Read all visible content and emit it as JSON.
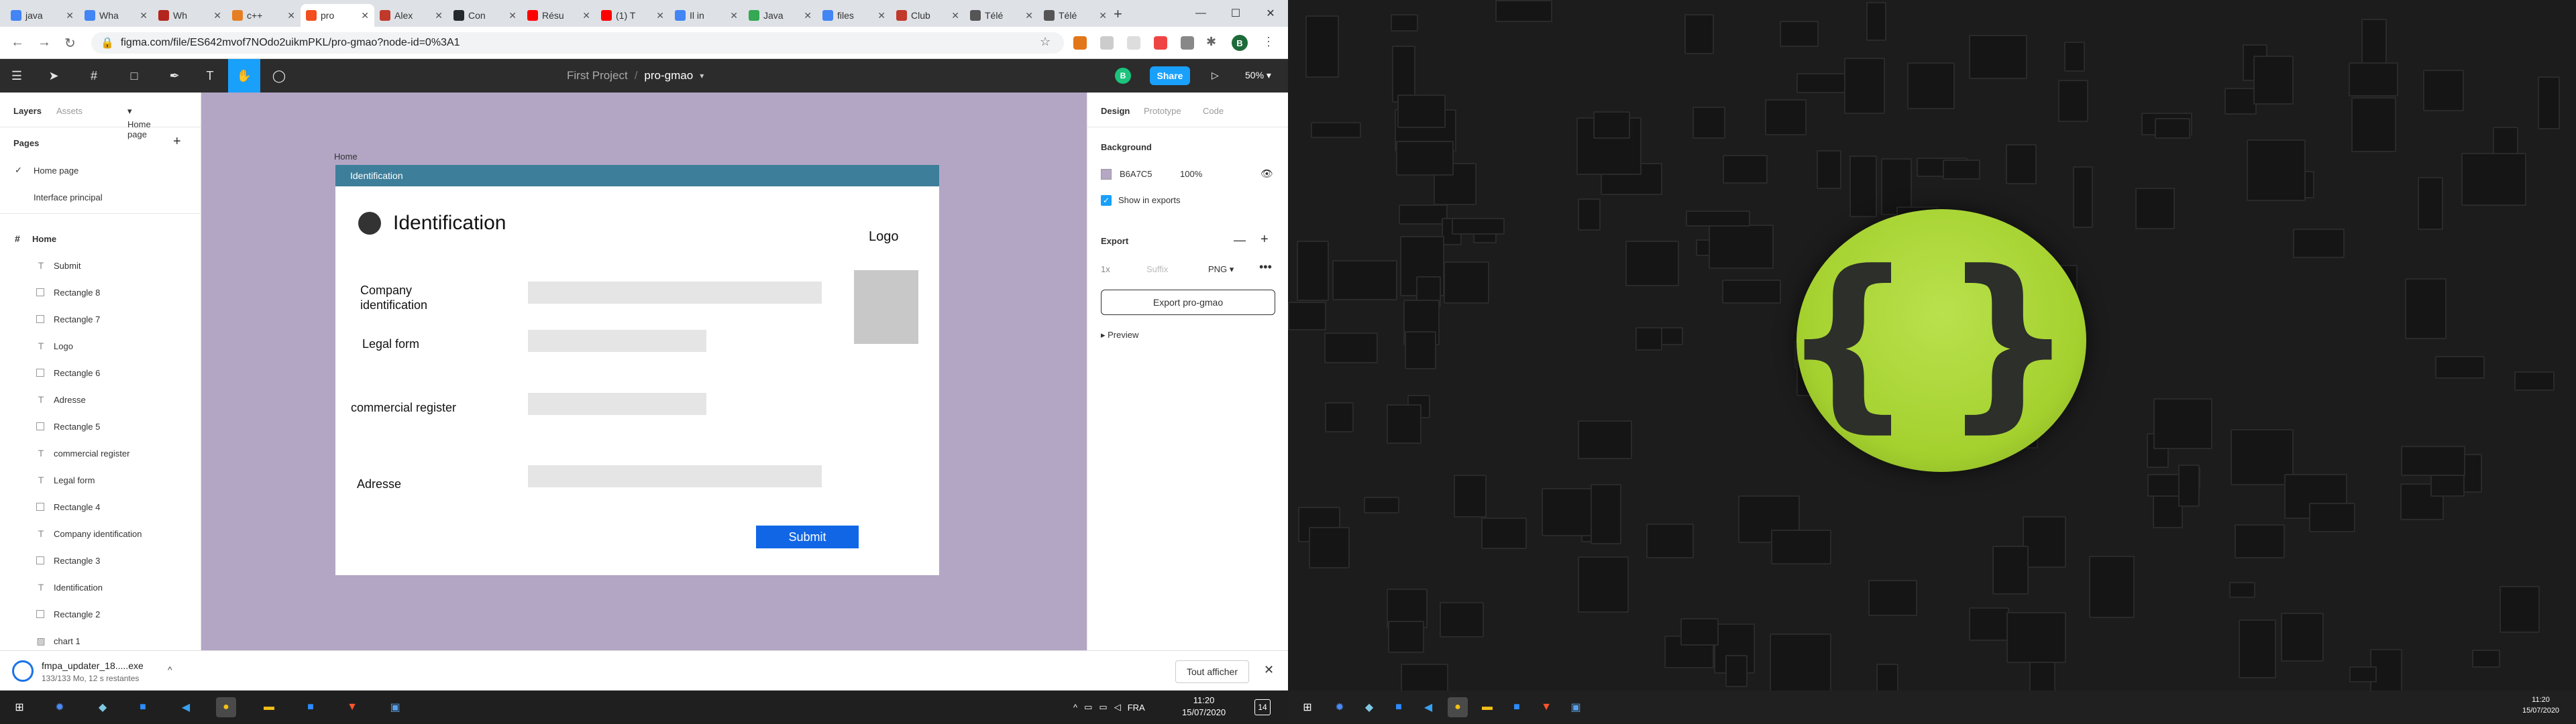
{
  "browser": {
    "tabs": [
      {
        "label": "java",
        "color": "#4285f4"
      },
      {
        "label": "Wha",
        "color": "#4285f4"
      },
      {
        "label": "Wh",
        "color": "#b3261e"
      },
      {
        "label": "c++",
        "color": "#e67e22"
      },
      {
        "label": "pro",
        "color": "#f24e1e"
      },
      {
        "label": "Alex",
        "color": "#c0392b"
      },
      {
        "label": "Con",
        "color": "#24292e"
      },
      {
        "label": "Résu",
        "color": "#ff0000"
      },
      {
        "label": "(1) T",
        "color": "#ff0000"
      },
      {
        "label": "Il in",
        "color": "#4285f4"
      },
      {
        "label": "Java",
        "color": "#34a853"
      },
      {
        "label": "files",
        "color": "#4285f4"
      },
      {
        "label": "Club",
        "color": "#c0392b"
      },
      {
        "label": "Télé",
        "color": "#555555"
      },
      {
        "label": "Télé",
        "color": "#555555"
      }
    ],
    "url": "figma.com/file/ES642mvof7NOdo2uikmPKL/pro-gmao?node-id=0%3A1",
    "profile_initial": "B"
  },
  "figma": {
    "breadcrumb_project": "First Project",
    "breadcrumb_sep": "/",
    "file_name": "pro-gmao",
    "avatar_initial": "B",
    "share_label": "Share",
    "zoom": "50%",
    "left_tabs": {
      "layers": "Layers",
      "assets": "Assets",
      "page_selector": "Home page"
    },
    "pages_header": "Pages",
    "pages": [
      "Home page",
      "Interface principal"
    ],
    "frame_layer": "Home",
    "layers": [
      {
        "label": "Submit",
        "icon": "text-icon"
      },
      {
        "label": "Rectangle 8",
        "icon": "rectangle-icon"
      },
      {
        "label": "Rectangle 7",
        "icon": "rectangle-icon"
      },
      {
        "label": "Logo",
        "icon": "text-icon"
      },
      {
        "label": "Rectangle 6",
        "icon": "rectangle-icon"
      },
      {
        "label": "Adresse",
        "icon": "text-icon"
      },
      {
        "label": "Rectangle 5",
        "icon": "rectangle-icon"
      },
      {
        "label": "commercial register",
        "icon": "text-icon"
      },
      {
        "label": "Legal form",
        "icon": "text-icon"
      },
      {
        "label": "Rectangle 4",
        "icon": "rectangle-icon"
      },
      {
        "label": "Company identification",
        "icon": "text-icon"
      },
      {
        "label": "Rectangle 3",
        "icon": "rectangle-icon"
      },
      {
        "label": "Identification",
        "icon": "text-icon"
      },
      {
        "label": "Rectangle 2",
        "icon": "rectangle-icon"
      },
      {
        "label": "chart 1",
        "icon": "image-icon"
      }
    ],
    "right_tabs": {
      "design": "Design",
      "prototype": "Prototype",
      "code": "Code"
    },
    "background": {
      "header": "Background",
      "hex": "B6A7C5",
      "opacity": "100%",
      "show_in_exports": "Show in exports"
    },
    "export": {
      "header": "Export",
      "scale": "1x",
      "suffix": "Suffix",
      "format": "PNG",
      "button": "Export pro-gmao",
      "preview": "Preview"
    }
  },
  "design_frame": {
    "frame_label": "Home",
    "header": "Identification",
    "title": "Identification",
    "logo": "Logo",
    "fields": {
      "company": "Company identification",
      "legal": "Legal form",
      "register": "commercial register",
      "address": "Adresse"
    },
    "submit": "Submit"
  },
  "colors": {
    "canvas": "#b3a6c5",
    "frame_header": "#3d7e9a",
    "submit": "#1166e6",
    "accent": "#18a0fb"
  },
  "downloads": {
    "file": "fmpa_updater_18.....exe",
    "status": "133/133 Mo, 12 s restantes",
    "show_all": "Tout afficher"
  },
  "taskbar_left": {
    "lang": "FRA",
    "time": "11:20",
    "date": "15/07/2020",
    "notif_count": "14"
  },
  "taskbar_right": {
    "time": "11:20",
    "date": "15/07/2020"
  }
}
